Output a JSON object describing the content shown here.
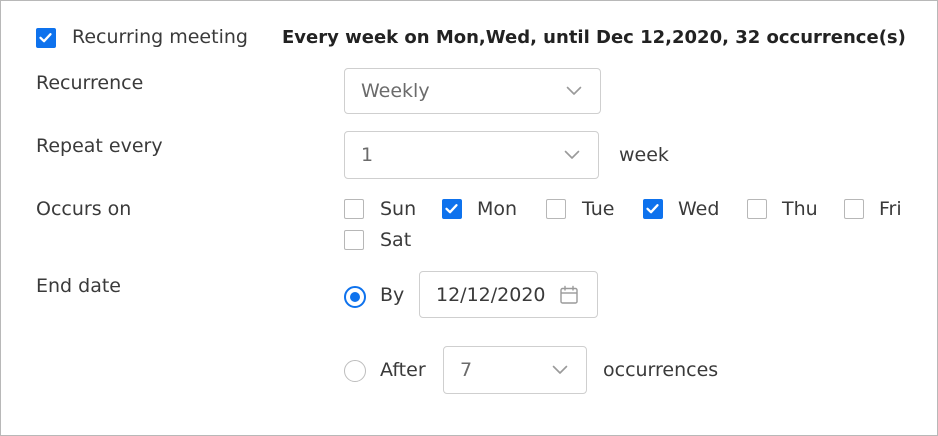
{
  "recurring": {
    "checkbox_checked": true,
    "label": "Recurring meeting",
    "summary": "Every week on Mon,Wed, until Dec 12,2020, 32 occurrence(s)"
  },
  "recurrence": {
    "label": "Recurrence",
    "value": "Weekly"
  },
  "repeat_every": {
    "label": "Repeat every",
    "value": "1",
    "unit": "week"
  },
  "occurs_on": {
    "label": "Occurs on",
    "days": [
      {
        "label": "Sun",
        "checked": false
      },
      {
        "label": "Mon",
        "checked": true
      },
      {
        "label": "Tue",
        "checked": false
      },
      {
        "label": "Wed",
        "checked": true
      },
      {
        "label": "Thu",
        "checked": false
      },
      {
        "label": "Fri",
        "checked": false
      },
      {
        "label": "Sat",
        "checked": false
      }
    ]
  },
  "end_date": {
    "label": "End date",
    "by": {
      "label": "By",
      "selected": true,
      "date": "12/12/2020"
    },
    "after": {
      "label": "After",
      "selected": false,
      "value": "7",
      "unit": "occurrences"
    }
  },
  "colors": {
    "accent": "#0e72ed",
    "border": "#cfcfcf",
    "text": "#3a3a3a"
  },
  "icons": {
    "check": "check-icon",
    "chevron": "chevron-down-icon",
    "calendar": "calendar-icon"
  }
}
